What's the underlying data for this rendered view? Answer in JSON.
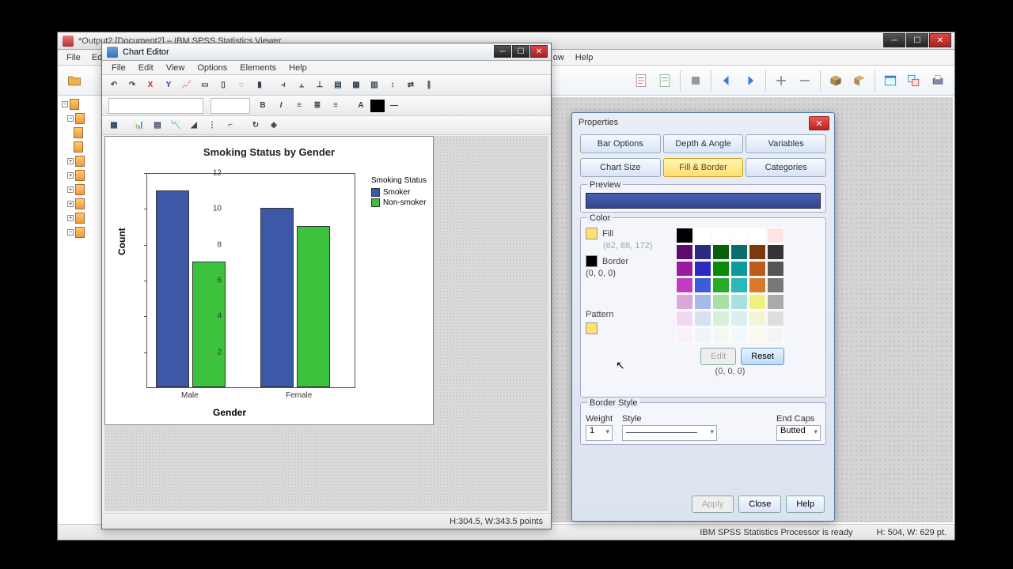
{
  "main": {
    "title": "*Output2 [Document2] – IBM SPSS Statistics Viewer",
    "menus": [
      "File",
      "Edit"
    ],
    "menu_tail": [
      "ow",
      "Help"
    ],
    "status_processor": "IBM SPSS Statistics Processor is ready",
    "status_dims": "H: 504, W: 629 pt."
  },
  "chart_editor": {
    "title": "Chart Editor",
    "menus": [
      "File",
      "Edit",
      "View",
      "Options",
      "Elements",
      "Help"
    ],
    "status": "H:304.5, W:343.5 points"
  },
  "chart_data": {
    "type": "bar",
    "title": "Smoking Status by Gender",
    "xlabel": "Gender",
    "ylabel": "Count",
    "categories": [
      "Male",
      "Female"
    ],
    "series": [
      {
        "name": "Smoker",
        "color": "#3e58a8",
        "values": [
          11,
          10
        ]
      },
      {
        "name": "Non-smoker",
        "color": "#3cc23c",
        "values": [
          7,
          9
        ]
      }
    ],
    "ylim": [
      0,
      12
    ],
    "yticks": [
      2,
      4,
      6,
      8,
      10,
      12
    ],
    "legend_title": "Smoking Status"
  },
  "properties": {
    "title": "Properties",
    "tabs_row1": [
      "Bar Options",
      "Depth & Angle",
      "Variables"
    ],
    "tabs_row2": [
      "Chart Size",
      "Fill & Border",
      "Categories"
    ],
    "active_tab": "Fill & Border",
    "preview_label": "Preview",
    "color_label": "Color",
    "fill_label": "Fill",
    "fill_rgb": "(62, 88, 172)",
    "border_label": "Border",
    "border_rgb": "(0, 0, 0)",
    "pattern_label": "Pattern",
    "edit_btn": "Edit",
    "reset_btn": "Reset",
    "grid_rgb": "(0, 0, 0)",
    "border_style_label": "Border Style",
    "weight_label": "Weight",
    "weight_value": "1",
    "style_label": "Style",
    "endcaps_label": "End Caps",
    "endcaps_value": "Butted",
    "apply_btn": "Apply",
    "close_btn": "Close",
    "help_btn": "Help",
    "swatches": [
      "#000000",
      "#ffffff",
      "#ffffff",
      "#ffffff",
      "#ffffff",
      "#ffe4e4",
      "#5e0a6e",
      "#2a2a80",
      "#0a5e0a",
      "#0a6e6e",
      "#7a3a0a",
      "#333333",
      "#9c1b9c",
      "#2a2ac0",
      "#0a8a0a",
      "#0a9c9c",
      "#c05a1a",
      "#555555",
      "#c03cc0",
      "#3c5cd8",
      "#2aaa2a",
      "#2ab8b8",
      "#d87a2a",
      "#777777",
      "#d8a8d8",
      "#a8b8e8",
      "#a8e0a8",
      "#a8e0e0",
      "#f0f080",
      "#aaaaaa",
      "#f0d8f0",
      "#d8e0f4",
      "#d8f0d8",
      "#d8f0f0",
      "#f4f4d8",
      "#dddddd",
      "#faf0fa",
      "#f0f4fa",
      "#f0faf0",
      "#f0fafa",
      "#fafaf0",
      "#f4f4f4"
    ]
  }
}
